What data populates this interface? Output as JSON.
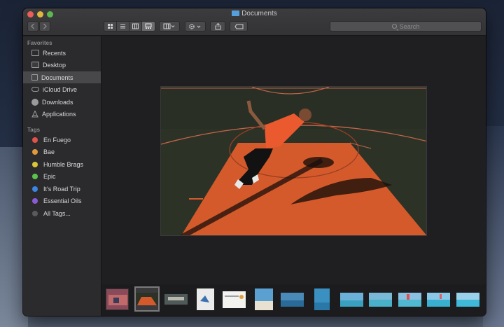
{
  "window": {
    "title": "Documents"
  },
  "toolbar": {
    "back_icon": "chevron-left-icon",
    "forward_icon": "chevron-right-icon",
    "view_modes": [
      "icon-view",
      "list-view",
      "column-view",
      "gallery-view"
    ],
    "active_view": "gallery-view",
    "search_placeholder": "Search"
  },
  "sidebar": {
    "favorites_header": "Favorites",
    "favorites": [
      {
        "label": "Recents",
        "icon": "clock-icon"
      },
      {
        "label": "Desktop",
        "icon": "desktop-icon"
      },
      {
        "label": "Documents",
        "icon": "document-icon",
        "selected": true
      },
      {
        "label": "iCloud Drive",
        "icon": "cloud-icon"
      },
      {
        "label": "Downloads",
        "icon": "download-icon"
      },
      {
        "label": "Applications",
        "icon": "applications-icon"
      }
    ],
    "tags_header": "Tags",
    "tags": [
      {
        "label": "En Fuego",
        "color": "#e2524a"
      },
      {
        "label": "Bae",
        "color": "#e09a3c"
      },
      {
        "label": "Humble Brags",
        "color": "#d9c73a"
      },
      {
        "label": "Epic",
        "color": "#5cc44c"
      },
      {
        "label": "It's Road Trip",
        "color": "#3a86e0"
      },
      {
        "label": "Essential Oils",
        "color": "#8a5bd6"
      },
      {
        "label": "All Tags...",
        "color": "#5a5a5c"
      }
    ]
  },
  "gallery": {
    "preview_subject": "basketball-court-photo",
    "thumbnail_count": 13,
    "selected_thumbnail": 2
  }
}
